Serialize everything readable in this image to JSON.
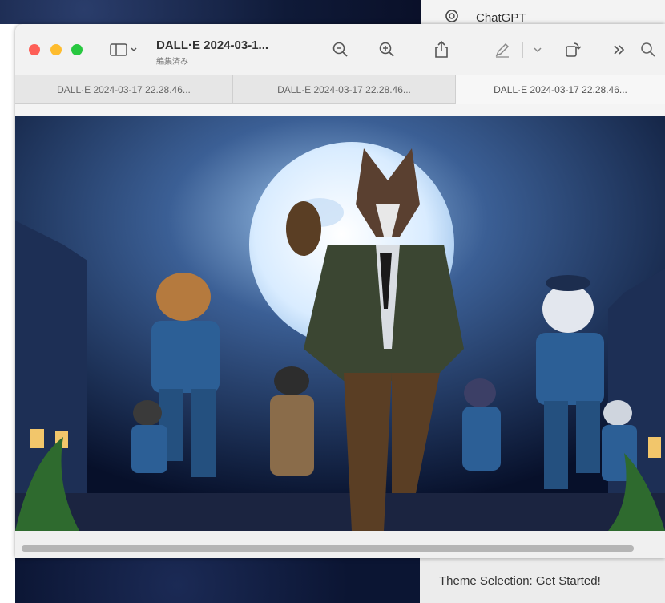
{
  "background": {
    "chatgpt_label": "ChatGPT",
    "theme_text": "Theme Selection: Get Started!"
  },
  "window": {
    "title": "DALL·E 2024-03-1...",
    "subtitle": "編集済み",
    "toolbar": {
      "icons": [
        "sidebar-icon",
        "zoom-out-icon",
        "zoom-in-icon",
        "share-icon",
        "markup-pen-icon",
        "rotate-icon",
        "more-icon",
        "search-icon"
      ]
    },
    "tabs": [
      {
        "label": "DALL·E 2024-03-17 22.28.46..."
      },
      {
        "label": "DALL·E 2024-03-17 22.28.46..."
      },
      {
        "label": "DALL·E 2024-03-17 22.28.46..."
      }
    ],
    "colors": {
      "close": "#fe5f57",
      "minimize": "#febc2e",
      "zoom": "#28c840"
    }
  }
}
